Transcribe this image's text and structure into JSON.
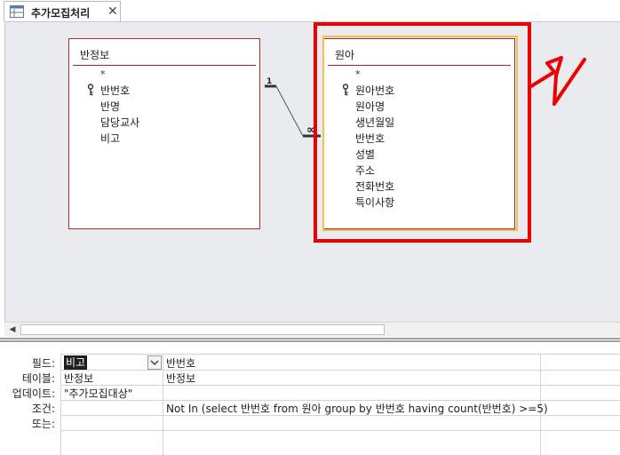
{
  "tab": {
    "title": "추가모집처리",
    "close_glyph": "✕",
    "icon": "query-icon"
  },
  "tables": {
    "class_table": {
      "title": "반정보",
      "star": "*",
      "fields": [
        "반번호",
        "반명",
        "담당교사",
        "비고"
      ],
      "key_field": "반번호"
    },
    "child_table": {
      "title": "원아",
      "star": "*",
      "fields": [
        "원아번호",
        "원아명",
        "생년월일",
        "반번호",
        "성별",
        "주소",
        "전화번호",
        "특이사항"
      ],
      "key_field": "원아번호"
    }
  },
  "relationship": {
    "one_label": "1",
    "many_label": "∞"
  },
  "grid": {
    "row_labels": {
      "field": "필드:",
      "table": "테이블:",
      "update": "업데이트:",
      "criteria": "조건:",
      "or": "또는:"
    },
    "col1": {
      "field": "비고",
      "table": "반정보",
      "update": "\"추가모집대상\"",
      "criteria": ""
    },
    "col2": {
      "field": "반번호",
      "table": "반정보",
      "update": "",
      "criteria": "Not In (select 반번호 from 원아 group by 반번호 having count(반번호) >=5)"
    }
  },
  "colors": {
    "highlight_red": "#ee0000",
    "selection_gold": "#f3c04f",
    "table_border": "#a03030"
  }
}
